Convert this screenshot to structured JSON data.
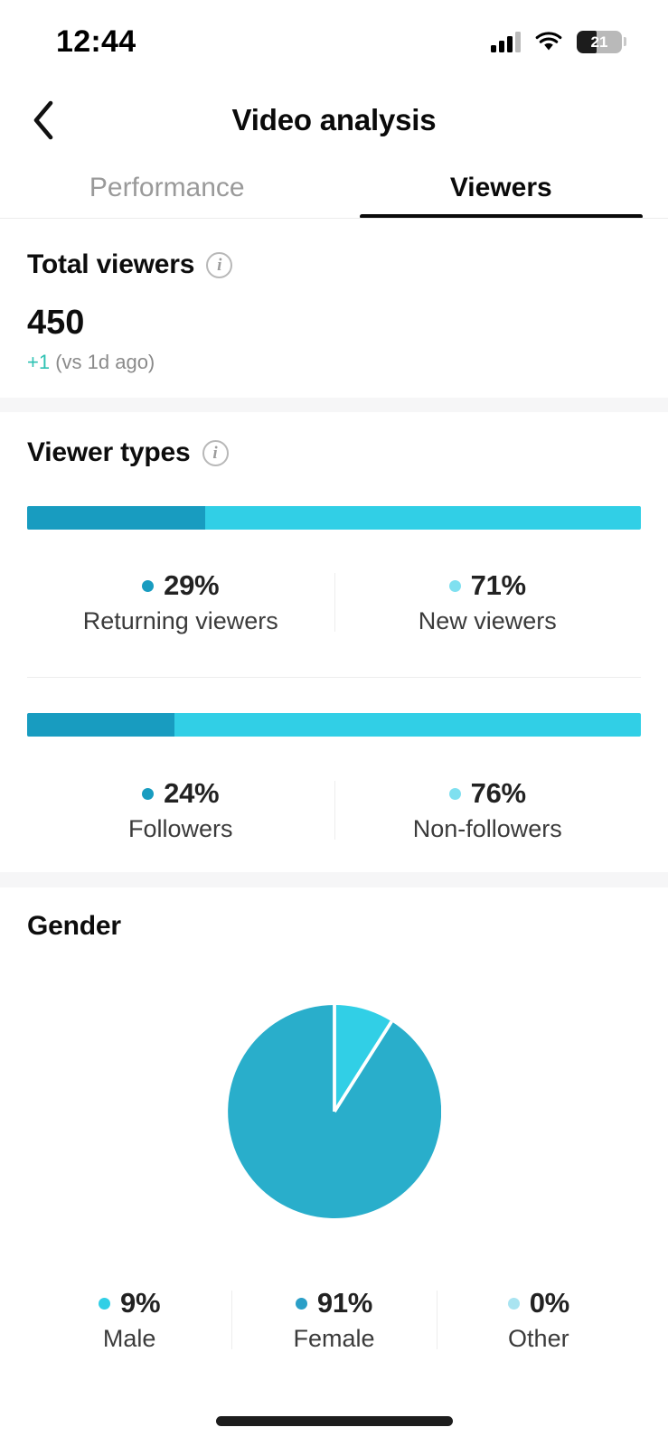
{
  "status_bar": {
    "time": "12:44",
    "battery_level": "21",
    "signal_icon": "cellular-signal-icon",
    "wifi_icon": "wifi-icon",
    "battery_icon": "battery-icon"
  },
  "nav": {
    "back_icon": "chevron-left-icon",
    "title": "Video analysis"
  },
  "tabs": [
    {
      "label": "Performance",
      "active": false
    },
    {
      "label": "Viewers",
      "active": true
    }
  ],
  "total_viewers": {
    "title": "Total viewers",
    "info_icon": "info-icon",
    "value": "450",
    "delta": "+1",
    "delta_suffix": " (vs 1d ago)"
  },
  "viewer_types": {
    "title": "Viewer types",
    "info_icon": "info-icon"
  },
  "gender": {
    "title": "Gender"
  },
  "colors": {
    "dark_teal": "#189cc0",
    "light_cyan": "#31cfe6",
    "pale_cyan": "#a9e4f1",
    "pie_major": "#29aecb",
    "delta_green": "#2ec2b3",
    "tab_active": "#0a0a0a",
    "tab_inactive": "#9a9a9a",
    "section_gap": "#f6f6f7"
  },
  "chart_data": [
    {
      "type": "bar",
      "orientation": "horizontal-stacked",
      "title": "Viewer types",
      "categories": [
        "Returning viewers",
        "New viewers"
      ],
      "values": [
        29,
        71
      ],
      "unit": "%",
      "labels": [
        "29%",
        "71%"
      ],
      "colors": [
        "#189cc0",
        "#31cfe6"
      ],
      "legend": "below",
      "grid": false
    },
    {
      "type": "bar",
      "orientation": "horizontal-stacked",
      "title": "Followers breakdown",
      "categories": [
        "Followers",
        "Non-followers"
      ],
      "values": [
        24,
        76
      ],
      "unit": "%",
      "labels": [
        "24%",
        "76%"
      ],
      "colors": [
        "#189cc0",
        "#31cfe6"
      ],
      "legend": "below",
      "grid": false
    },
    {
      "type": "pie",
      "title": "Gender",
      "categories": [
        "Male",
        "Female",
        "Other"
      ],
      "values": [
        9,
        91,
        0
      ],
      "unit": "%",
      "labels": [
        "9%",
        "91%",
        "0%"
      ],
      "colors": [
        "#31cfe6",
        "#29aecb",
        "#a9e4f1"
      ],
      "start_angle_deg": 0,
      "direction": "clockwise",
      "legend": "below",
      "grid": false
    }
  ]
}
